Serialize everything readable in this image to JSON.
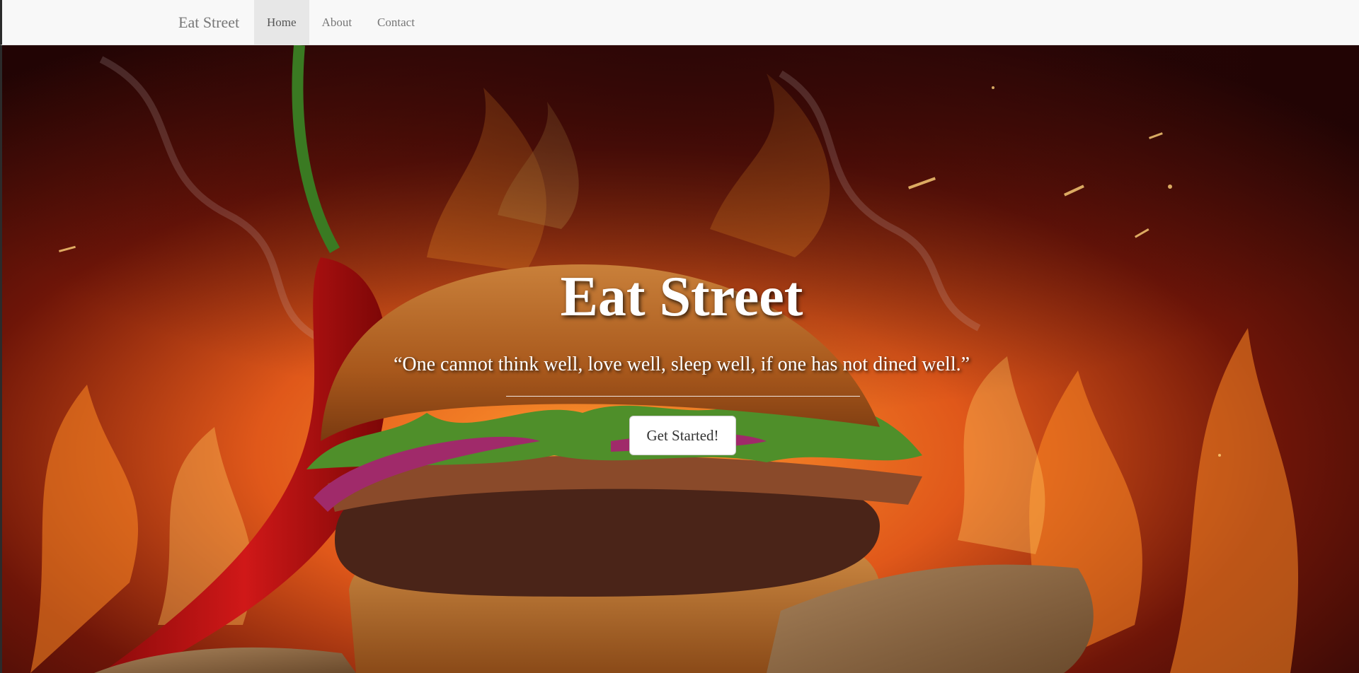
{
  "navbar": {
    "brand": "Eat Street",
    "items": [
      {
        "label": "Home",
        "active": true
      },
      {
        "label": "About",
        "active": false
      },
      {
        "label": "Contact",
        "active": false
      }
    ]
  },
  "hero": {
    "title": "Eat Street",
    "quote": "“One cannot think well, love well, sleep well, if one has not dined well.”",
    "cta_label": "Get Started!",
    "background_description_icon": "burger-fire-photo"
  },
  "colors": {
    "navbar_bg": "#f8f8f8",
    "active_tab_bg": "#e7e7e7",
    "nav_text": "#777777",
    "hero_text": "#ffffff"
  }
}
